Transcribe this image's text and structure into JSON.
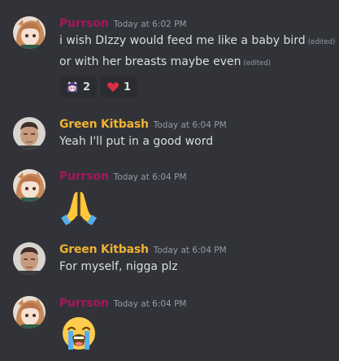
{
  "messages": [
    {
      "author": "Purrson",
      "timestamp": "Today at 6:02 PM",
      "avatar_icon": "anime-girl-avatar",
      "lines": [
        {
          "text": "i wish DIzzy would feed me like a baby bird",
          "edited": "(edited)"
        },
        {
          "text": "or with her breasts maybe even",
          "edited": "(edited)"
        }
      ],
      "reactions": [
        {
          "emoji": "anime-girl-emoji",
          "count": "2"
        },
        {
          "emoji": "red-heart-emoji",
          "count": "1"
        }
      ]
    },
    {
      "author": "Green Kitbash",
      "timestamp": "Today at 6:04 PM",
      "avatar_icon": "man-portrait-avatar",
      "lines": [
        {
          "text": "Yeah I'll put in a good word"
        }
      ]
    },
    {
      "author": "Purrson",
      "timestamp": "Today at 6:04 PM",
      "avatar_icon": "anime-girl-avatar",
      "emoji": "folded-hands-emoji"
    },
    {
      "author": "Green Kitbash",
      "timestamp": "Today at 6:04 PM",
      "avatar_icon": "man-portrait-avatar",
      "lines": [
        {
          "text": "For myself, nigga plz"
        }
      ]
    },
    {
      "author": "Purrson",
      "timestamp": "Today at 6:04 PM",
      "avatar_icon": "anime-girl-avatar",
      "emoji": "loudly-crying-face-emoji"
    }
  ],
  "colors": {
    "background": "#313338",
    "purrson_name": "#a3185b",
    "green_kitbash_name": "#f0b232",
    "message_text": "#dbdee1",
    "muted_text": "#949ba4",
    "reaction_bg": "#2b2d31"
  }
}
